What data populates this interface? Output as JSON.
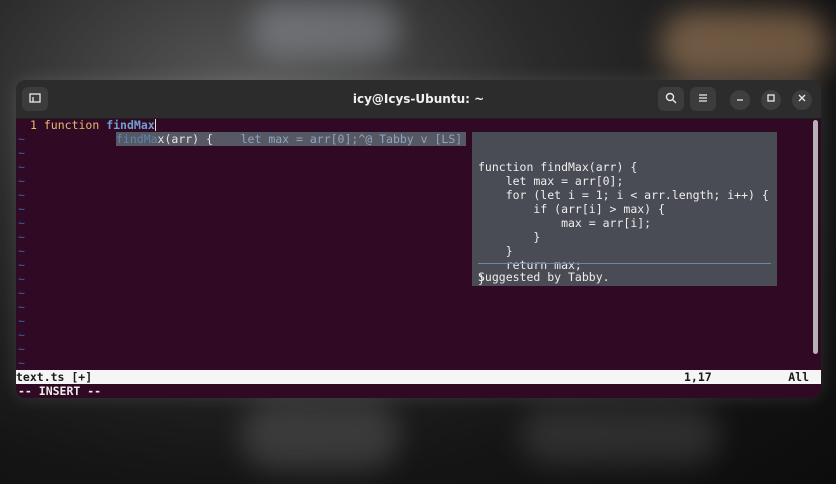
{
  "window": {
    "title": "icy@Icys-Ubuntu: ~"
  },
  "icons": {
    "new_tab": "new-tab-icon",
    "search": "search-icon",
    "menu": "hamburger-menu-icon",
    "minimize": "minimize-icon",
    "maximize": "maximize-icon",
    "close": "close-icon"
  },
  "editor": {
    "line_number": "1",
    "keyword": "function",
    "typed_name": "findMax",
    "tilde": "~",
    "tilde_rows": 17
  },
  "ghost": {
    "typed": "findMa",
    "rest": "x(arr) {",
    "inline_preview": "    let max = arr[0];^@ Tabby v [LS]"
  },
  "suggestion": {
    "code": "function findMax(arr) {\n    let max = arr[0];\n    for (let i = 1; i < arr.length; i++) {\n        if (arr[i] > max) {\n            max = arr[i];\n        }\n    }\n    return max;\n}",
    "footer": "Suggested by Tabby."
  },
  "status_line": {
    "file": "text.ts [+]",
    "position": "1,17",
    "scroll": "All"
  },
  "mode_line": "-- INSERT --",
  "colors": {
    "terminal_bg": "#300a24",
    "titlebar_bg": "#2c2c2c",
    "popup_bg": "#4a4c55",
    "keyword": "#e9b96e",
    "identifier": "#729fcf",
    "tilde": "#3465a4"
  }
}
